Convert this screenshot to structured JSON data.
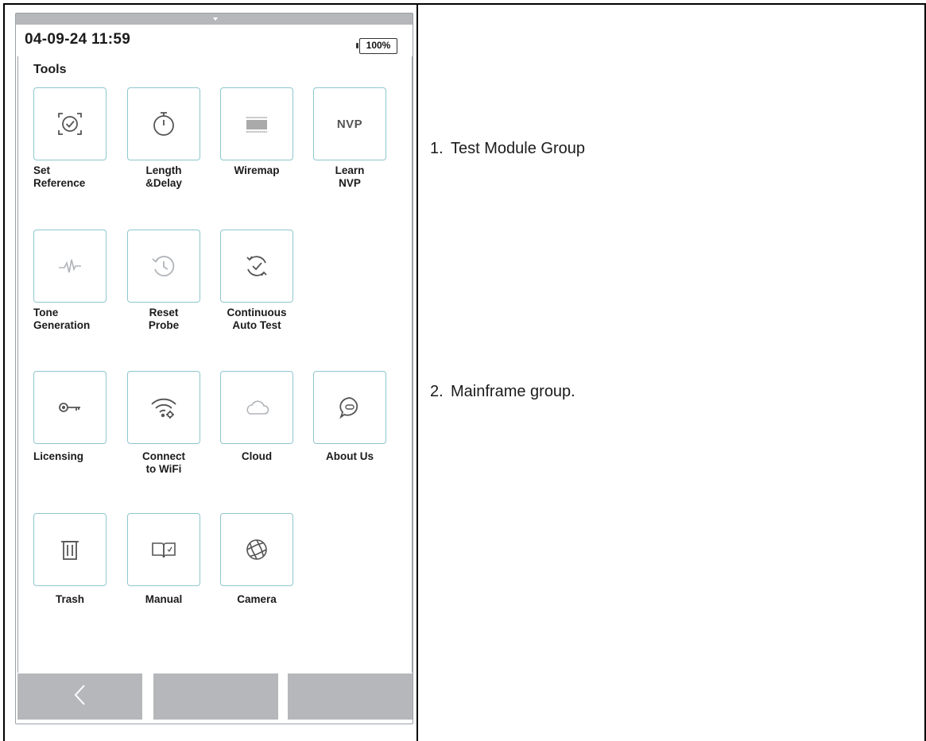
{
  "device": {
    "datetime": "04-09-24 11:59",
    "battery": "100%",
    "section_title": "Tools"
  },
  "tools": [
    {
      "label_line1": "Set",
      "label_line2": "Reference",
      "icon": "target-icon"
    },
    {
      "label_line1": "Length",
      "label_line2": "&Delay",
      "icon": "stopwatch-icon"
    },
    {
      "label_line1": "Wiremap",
      "label_line2": "",
      "icon": "barcode-icon"
    },
    {
      "label_line1": "Learn",
      "label_line2": "NVP",
      "icon_text": "NVP"
    },
    {
      "label_line1": "Tone",
      "label_line2": "Generation",
      "icon": "waveform-icon"
    },
    {
      "label_line1": "Reset",
      "label_line2": "Probe",
      "icon": "history-icon"
    },
    {
      "label_line1": "Continuous",
      "label_line2": "Auto Test",
      "icon": "refresh-check-icon"
    },
    {
      "label_line1": "Licensing",
      "label_line2": "",
      "icon": "key-icon"
    },
    {
      "label_line1": "Connect",
      "label_line2": "to WiFi",
      "icon": "wifi-gear-icon"
    },
    {
      "label_line1": "Cloud",
      "label_line2": "",
      "icon": "cloud-icon"
    },
    {
      "label_line1": "About Us",
      "label_line2": "",
      "icon": "chat-bubble-icon"
    },
    {
      "label_line1": "Trash",
      "label_line2": "",
      "icon": "trash-icon"
    },
    {
      "label_line1": "Manual",
      "label_line2": "",
      "icon": "book-icon"
    },
    {
      "label_line1": "Camera",
      "label_line2": "",
      "icon": "aperture-icon"
    }
  ],
  "nav": {
    "back_icon": "chevron-left-icon"
  },
  "annotations": [
    {
      "number": "1.",
      "text": "Test Module Group"
    },
    {
      "number": "2.",
      "text": "Mainframe group."
    }
  ],
  "colors": {
    "tile_border": "#8ec7cf",
    "bar_gray": "#b5b7ba",
    "icon_dark": "#555555",
    "icon_light": "#b0b4b8"
  }
}
